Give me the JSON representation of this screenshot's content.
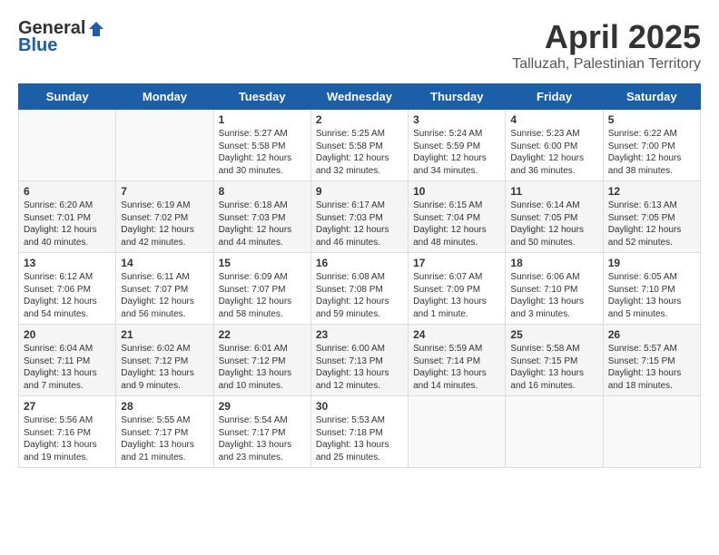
{
  "header": {
    "logo_general": "General",
    "logo_blue": "Blue",
    "month_title": "April 2025",
    "subtitle": "Talluzah, Palestinian Territory"
  },
  "weekdays": [
    "Sunday",
    "Monday",
    "Tuesday",
    "Wednesday",
    "Thursday",
    "Friday",
    "Saturday"
  ],
  "weeks": [
    [
      {
        "day": "",
        "info": ""
      },
      {
        "day": "",
        "info": ""
      },
      {
        "day": "1",
        "info": "Sunrise: 5:27 AM\nSunset: 5:58 PM\nDaylight: 12 hours\nand 30 minutes."
      },
      {
        "day": "2",
        "info": "Sunrise: 5:25 AM\nSunset: 5:58 PM\nDaylight: 12 hours\nand 32 minutes."
      },
      {
        "day": "3",
        "info": "Sunrise: 5:24 AM\nSunset: 5:59 PM\nDaylight: 12 hours\nand 34 minutes."
      },
      {
        "day": "4",
        "info": "Sunrise: 5:23 AM\nSunset: 6:00 PM\nDaylight: 12 hours\nand 36 minutes."
      },
      {
        "day": "5",
        "info": "Sunrise: 6:22 AM\nSunset: 7:00 PM\nDaylight: 12 hours\nand 38 minutes."
      }
    ],
    [
      {
        "day": "6",
        "info": "Sunrise: 6:20 AM\nSunset: 7:01 PM\nDaylight: 12 hours\nand 40 minutes."
      },
      {
        "day": "7",
        "info": "Sunrise: 6:19 AM\nSunset: 7:02 PM\nDaylight: 12 hours\nand 42 minutes."
      },
      {
        "day": "8",
        "info": "Sunrise: 6:18 AM\nSunset: 7:03 PM\nDaylight: 12 hours\nand 44 minutes."
      },
      {
        "day": "9",
        "info": "Sunrise: 6:17 AM\nSunset: 7:03 PM\nDaylight: 12 hours\nand 46 minutes."
      },
      {
        "day": "10",
        "info": "Sunrise: 6:15 AM\nSunset: 7:04 PM\nDaylight: 12 hours\nand 48 minutes."
      },
      {
        "day": "11",
        "info": "Sunrise: 6:14 AM\nSunset: 7:05 PM\nDaylight: 12 hours\nand 50 minutes."
      },
      {
        "day": "12",
        "info": "Sunrise: 6:13 AM\nSunset: 7:05 PM\nDaylight: 12 hours\nand 52 minutes."
      }
    ],
    [
      {
        "day": "13",
        "info": "Sunrise: 6:12 AM\nSunset: 7:06 PM\nDaylight: 12 hours\nand 54 minutes."
      },
      {
        "day": "14",
        "info": "Sunrise: 6:11 AM\nSunset: 7:07 PM\nDaylight: 12 hours\nand 56 minutes."
      },
      {
        "day": "15",
        "info": "Sunrise: 6:09 AM\nSunset: 7:07 PM\nDaylight: 12 hours\nand 58 minutes."
      },
      {
        "day": "16",
        "info": "Sunrise: 6:08 AM\nSunset: 7:08 PM\nDaylight: 12 hours\nand 59 minutes."
      },
      {
        "day": "17",
        "info": "Sunrise: 6:07 AM\nSunset: 7:09 PM\nDaylight: 13 hours\nand 1 minute."
      },
      {
        "day": "18",
        "info": "Sunrise: 6:06 AM\nSunset: 7:10 PM\nDaylight: 13 hours\nand 3 minutes."
      },
      {
        "day": "19",
        "info": "Sunrise: 6:05 AM\nSunset: 7:10 PM\nDaylight: 13 hours\nand 5 minutes."
      }
    ],
    [
      {
        "day": "20",
        "info": "Sunrise: 6:04 AM\nSunset: 7:11 PM\nDaylight: 13 hours\nand 7 minutes."
      },
      {
        "day": "21",
        "info": "Sunrise: 6:02 AM\nSunset: 7:12 PM\nDaylight: 13 hours\nand 9 minutes."
      },
      {
        "day": "22",
        "info": "Sunrise: 6:01 AM\nSunset: 7:12 PM\nDaylight: 13 hours\nand 10 minutes."
      },
      {
        "day": "23",
        "info": "Sunrise: 6:00 AM\nSunset: 7:13 PM\nDaylight: 13 hours\nand 12 minutes."
      },
      {
        "day": "24",
        "info": "Sunrise: 5:59 AM\nSunset: 7:14 PM\nDaylight: 13 hours\nand 14 minutes."
      },
      {
        "day": "25",
        "info": "Sunrise: 5:58 AM\nSunset: 7:15 PM\nDaylight: 13 hours\nand 16 minutes."
      },
      {
        "day": "26",
        "info": "Sunrise: 5:57 AM\nSunset: 7:15 PM\nDaylight: 13 hours\nand 18 minutes."
      }
    ],
    [
      {
        "day": "27",
        "info": "Sunrise: 5:56 AM\nSunset: 7:16 PM\nDaylight: 13 hours\nand 19 minutes."
      },
      {
        "day": "28",
        "info": "Sunrise: 5:55 AM\nSunset: 7:17 PM\nDaylight: 13 hours\nand 21 minutes."
      },
      {
        "day": "29",
        "info": "Sunrise: 5:54 AM\nSunset: 7:17 PM\nDaylight: 13 hours\nand 23 minutes."
      },
      {
        "day": "30",
        "info": "Sunrise: 5:53 AM\nSunset: 7:18 PM\nDaylight: 13 hours\nand 25 minutes."
      },
      {
        "day": "",
        "info": ""
      },
      {
        "day": "",
        "info": ""
      },
      {
        "day": "",
        "info": ""
      }
    ]
  ]
}
